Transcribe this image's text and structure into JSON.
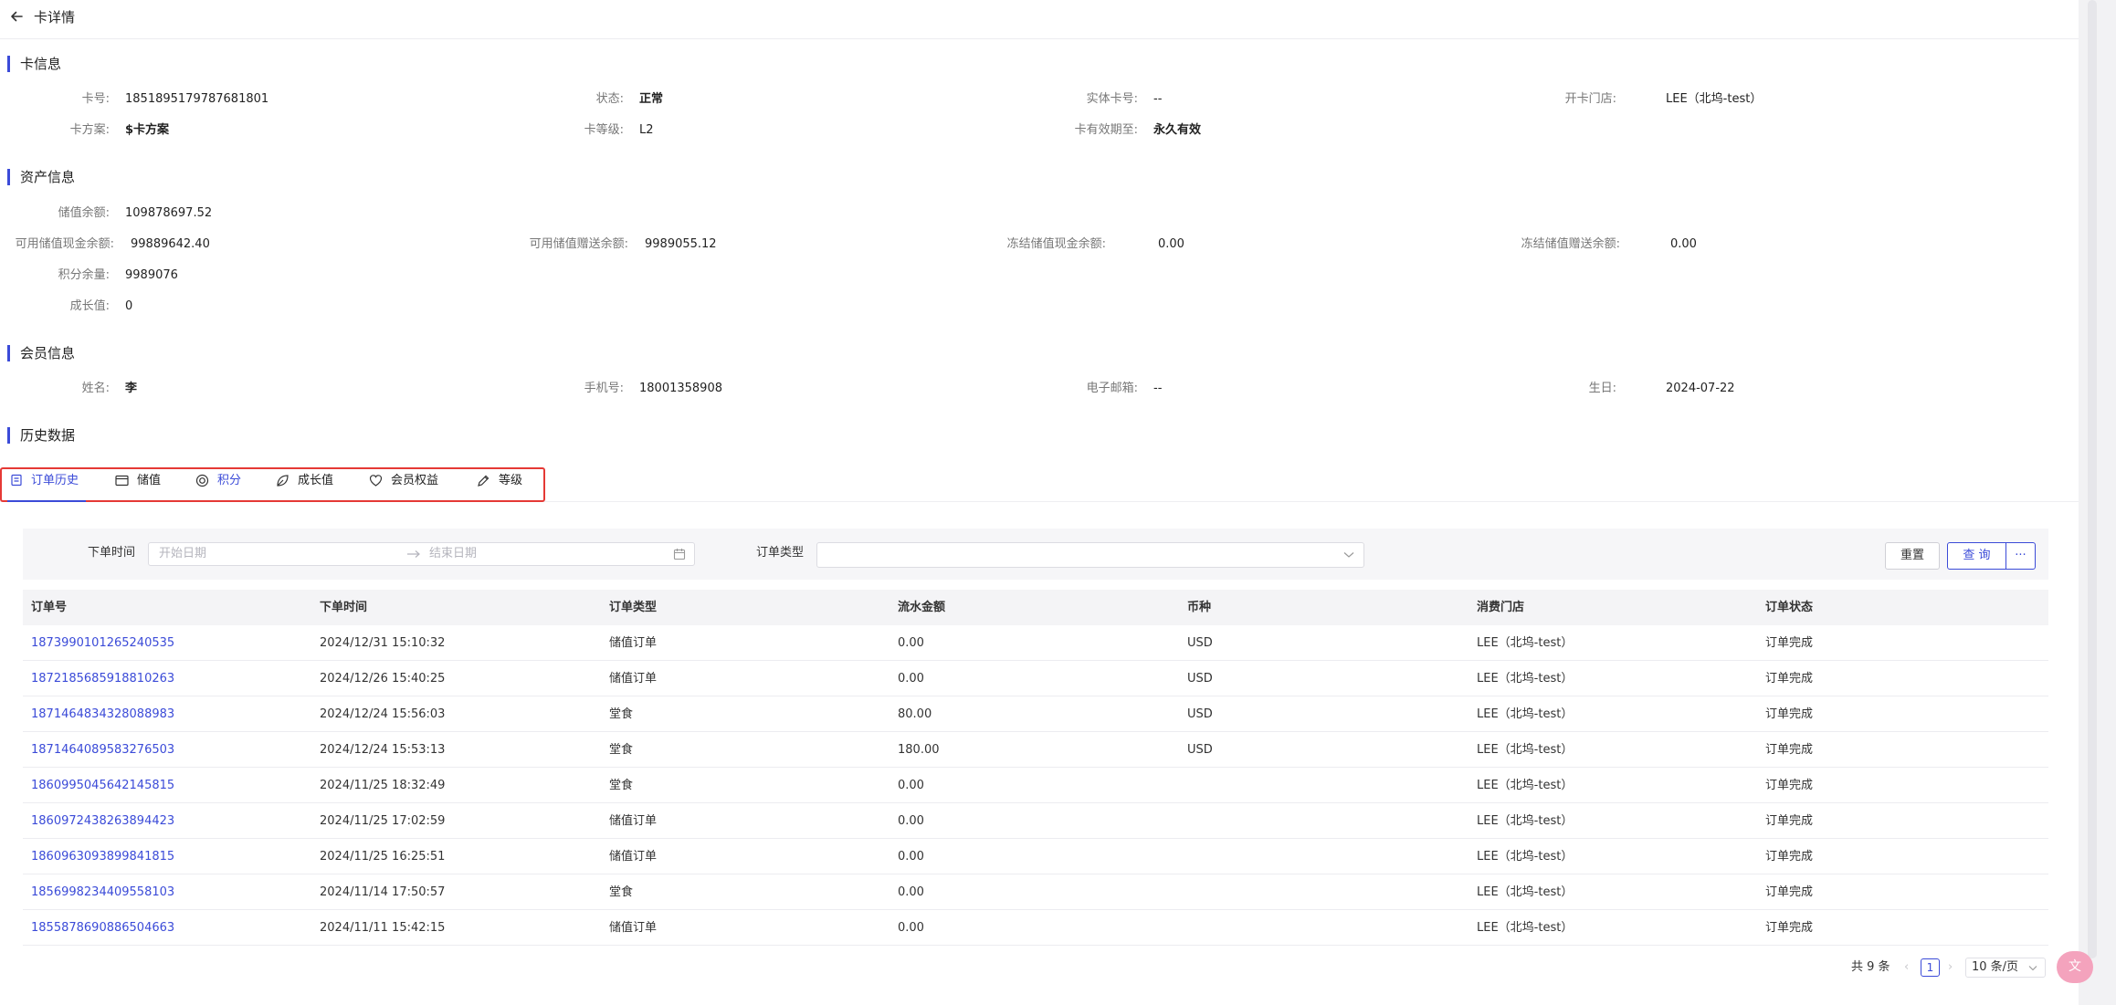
{
  "header": {
    "title": "卡详情"
  },
  "sections": {
    "card": "卡信息",
    "assets": "资产信息",
    "member": "会员信息",
    "history": "历史数据"
  },
  "card_info": {
    "card_no_label": "卡号:",
    "card_no": "1851895179787681801",
    "status_label": "状态:",
    "status": "正常",
    "physical_label": "实体卡号:",
    "physical": "--",
    "store_label": "开卡门店:",
    "store": "LEE（北坞-test）",
    "plan_label": "卡方案:",
    "plan": "$卡方案",
    "level_label": "卡等级:",
    "level": "L2",
    "expiry_label": "卡有效期至:",
    "expiry": "永久有效"
  },
  "asset_info": {
    "balance_label": "储值余额:",
    "balance": "109878697.52",
    "cash_label": "可用储值现金余额:",
    "cash": "99889642.40",
    "gift_label": "可用储值赠送余额:",
    "gift": "9989055.12",
    "frozen_cash_label": "冻结储值现金余额:",
    "frozen_cash": "0.00",
    "frozen_gift_label": "冻结储值赠送余额:",
    "frozen_gift": "0.00",
    "points_label": "积分余量:",
    "points": "9989076",
    "growth_label": "成长值:",
    "growth": "0"
  },
  "member_info": {
    "name_label": "姓名:",
    "name": "李",
    "phone_label": "手机号:",
    "phone": "18001358908",
    "email_label": "电子邮箱:",
    "email": "--",
    "birthday_label": "生日:",
    "birthday": "2024-07-22"
  },
  "tabs": [
    {
      "label": "订单历史",
      "icon": "order-icon"
    },
    {
      "label": "储值",
      "icon": "wallet-icon"
    },
    {
      "label": "积分",
      "icon": "points-icon"
    },
    {
      "label": "成长值",
      "icon": "leaf-icon"
    },
    {
      "label": "会员权益",
      "icon": "gift-icon"
    },
    {
      "label": "等级",
      "icon": "edit-icon"
    }
  ],
  "filter": {
    "time_label": "下单时间",
    "start_placeholder": "开始日期",
    "end_placeholder": "结束日期",
    "type_label": "订单类型",
    "reset": "重置",
    "query": "查 询",
    "more": "···"
  },
  "table": {
    "columns": [
      "订单号",
      "下单时间",
      "订单类型",
      "流水金额",
      "币种",
      "消费门店",
      "订单状态"
    ],
    "rows": [
      [
        "1873990101265240535",
        "2024/12/31 15:10:32",
        "储值订单",
        "0.00",
        "USD",
        "LEE（北坞-test）",
        "订单完成"
      ],
      [
        "1872185685918810263",
        "2024/12/26 15:40:25",
        "储值订单",
        "0.00",
        "USD",
        "LEE（北坞-test）",
        "订单完成"
      ],
      [
        "1871464834328088983",
        "2024/12/24 15:56:03",
        "堂食",
        "80.00",
        "USD",
        "LEE（北坞-test）",
        "订单完成"
      ],
      [
        "1871464089583276503",
        "2024/12/24 15:53:13",
        "堂食",
        "180.00",
        "USD",
        "LEE（北坞-test）",
        "订单完成"
      ],
      [
        "1860995045642145815",
        "2024/11/25 18:32:49",
        "堂食",
        "0.00",
        "",
        "LEE（北坞-test）",
        "订单完成"
      ],
      [
        "1860972438263894423",
        "2024/11/25 17:02:59",
        "储值订单",
        "0.00",
        "",
        "LEE（北坞-test）",
        "订单完成"
      ],
      [
        "1860963093899841815",
        "2024/11/25 16:25:51",
        "储值订单",
        "0.00",
        "",
        "LEE（北坞-test）",
        "订单完成"
      ],
      [
        "1856998234409558103",
        "2024/11/14 17:50:57",
        "堂食",
        "0.00",
        "",
        "LEE（北坞-test）",
        "订单完成"
      ],
      [
        "1855878690886504663",
        "2024/11/11 15:42:15",
        "储值订单",
        "0.00",
        "",
        "LEE（北坞-test）",
        "订单完成"
      ]
    ]
  },
  "pagination": {
    "total": "共 9 条",
    "current": "1",
    "page_size": "10 条/页"
  },
  "colors": {
    "accent": "#3b4bd8",
    "highlight_border": "#e53935"
  }
}
